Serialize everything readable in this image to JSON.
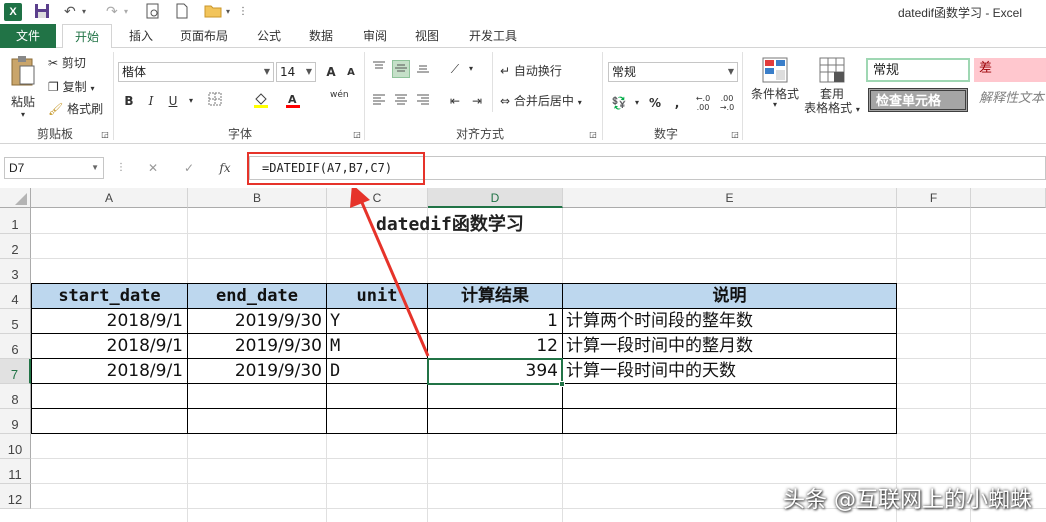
{
  "window": {
    "title": "datedif函数学习 - Excel",
    "app_icon": "excel-logo-icon"
  },
  "tabs": [
    "文件",
    "开始",
    "插入",
    "页面布局",
    "公式",
    "数据",
    "审阅",
    "视图",
    "开发工具"
  ],
  "ribbon": {
    "clipboard": {
      "paste": "粘贴",
      "cut": "剪切",
      "copy": "复制",
      "format_painter": "格式刷",
      "label": "剪贴板"
    },
    "font": {
      "name": "楷体",
      "size": "14",
      "bold": "B",
      "italic": "I",
      "underline": "U",
      "label": "字体",
      "grow": "A",
      "shrink": "A",
      "phonetic": "wén"
    },
    "alignment": {
      "wrap": "自动换行",
      "merge": "合并后居中",
      "label": "对齐方式"
    },
    "number": {
      "format": "常规",
      "percent": "%",
      "comma": ",",
      "label": "数字"
    },
    "styles": {
      "conditional": "条件格式",
      "table_format_1": "套用",
      "table_format_2": "表格格式",
      "normal": "常规",
      "bad": "差",
      "check_cell": "检查单元格",
      "explanatory": "解释性文本"
    }
  },
  "formula_bar": {
    "name_box": "D7",
    "cancel": "✕",
    "enter": "✓",
    "fx": "fx",
    "formula": "=DATEDIF(A7,B7,C7)"
  },
  "grid": {
    "columns": [
      "A",
      "B",
      "C",
      "D",
      "E",
      "F"
    ],
    "rows": [
      "1",
      "2",
      "3",
      "4",
      "5",
      "6",
      "7",
      "8",
      "9",
      "10",
      "11",
      "12"
    ],
    "sheet_title": "datedif函数学习",
    "headers": [
      "start_date",
      "end_date",
      "unit",
      "计算结果",
      "说明"
    ],
    "data": [
      [
        "2018/9/1",
        "2019/9/30",
        "Y",
        "1",
        "计算两个时间段的整年数"
      ],
      [
        "2018/9/1",
        "2019/9/30",
        "M",
        "12",
        "计算一段时间中的整月数"
      ],
      [
        "2018/9/1",
        "2019/9/30",
        "D",
        "394",
        "计算一段时间中的天数"
      ]
    ]
  },
  "watermark": "头条 @互联网上的小蜘蛛",
  "colors": {
    "accent": "#217346",
    "header_fill": "#bdd7ee",
    "highlight": "#e6332a",
    "bad_fill": "#ffc7ce",
    "normal_border": "#9fd7b3"
  }
}
